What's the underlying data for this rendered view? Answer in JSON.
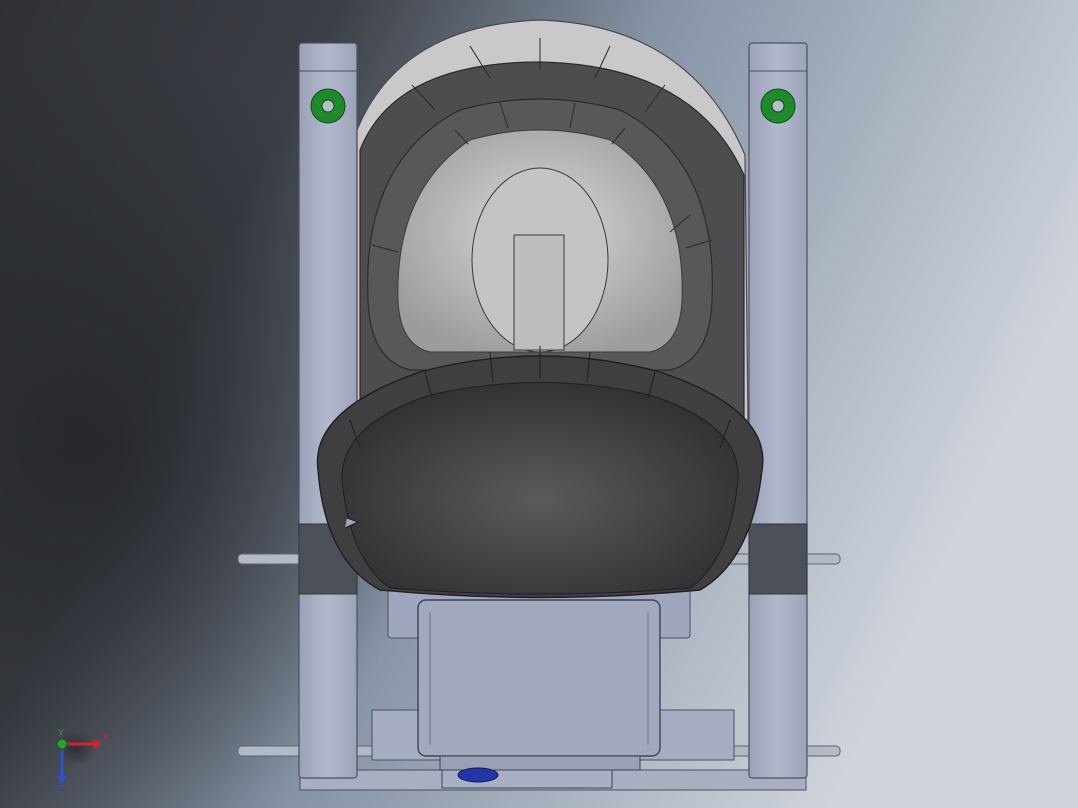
{
  "viewport": {
    "background_colors": [
      "#3a3c41",
      "#8a99ab",
      "#c9cfd8"
    ]
  },
  "model": {
    "frame_color": "#a7aec4",
    "seat_color": "#444446",
    "hole_ring_color": "#1f8a2a",
    "fastener_color": "#2236a8"
  },
  "triad": {
    "x_label": "X",
    "y_label": "Y",
    "z_label": "Z",
    "x_color": "#d8202a",
    "y_color": "#27a12f",
    "z_color": "#2d4fd0"
  }
}
